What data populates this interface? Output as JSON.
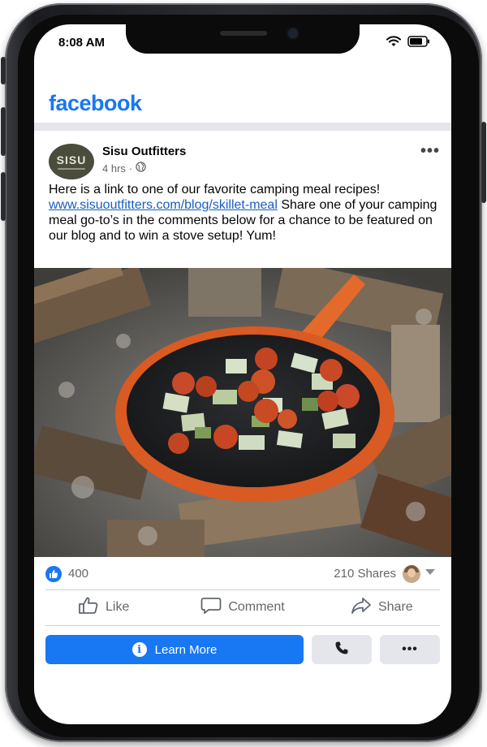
{
  "status_bar": {
    "time": "8:08 AM",
    "icons": [
      "wifi-icon",
      "battery-icon"
    ]
  },
  "app": {
    "logo_text": "facebook",
    "brand_color": "#1877f2"
  },
  "post": {
    "page_name": "Sisu Outfitters",
    "avatar_text": "SISU",
    "timestamp": "4 hrs",
    "separator": "·",
    "privacy_icon": "globe-icon",
    "body_before_link": "Here is a link to one of our favorite camping meal recipes!",
    "link_text": "www.sisuoutfitters.com/blog/skillet-meal",
    "body_after_link": "Share one of your camping meal go-to’s in the comments below for a chance to be featured on our blog and to win a stove setup! Yum!",
    "more_menu": "•••"
  },
  "engagement": {
    "reaction_count": "400",
    "shares_text": "210 Shares"
  },
  "actions": {
    "like": "Like",
    "comment": "Comment",
    "share": "Share"
  },
  "cta": {
    "learn_more": "Learn More",
    "more": "•••"
  }
}
